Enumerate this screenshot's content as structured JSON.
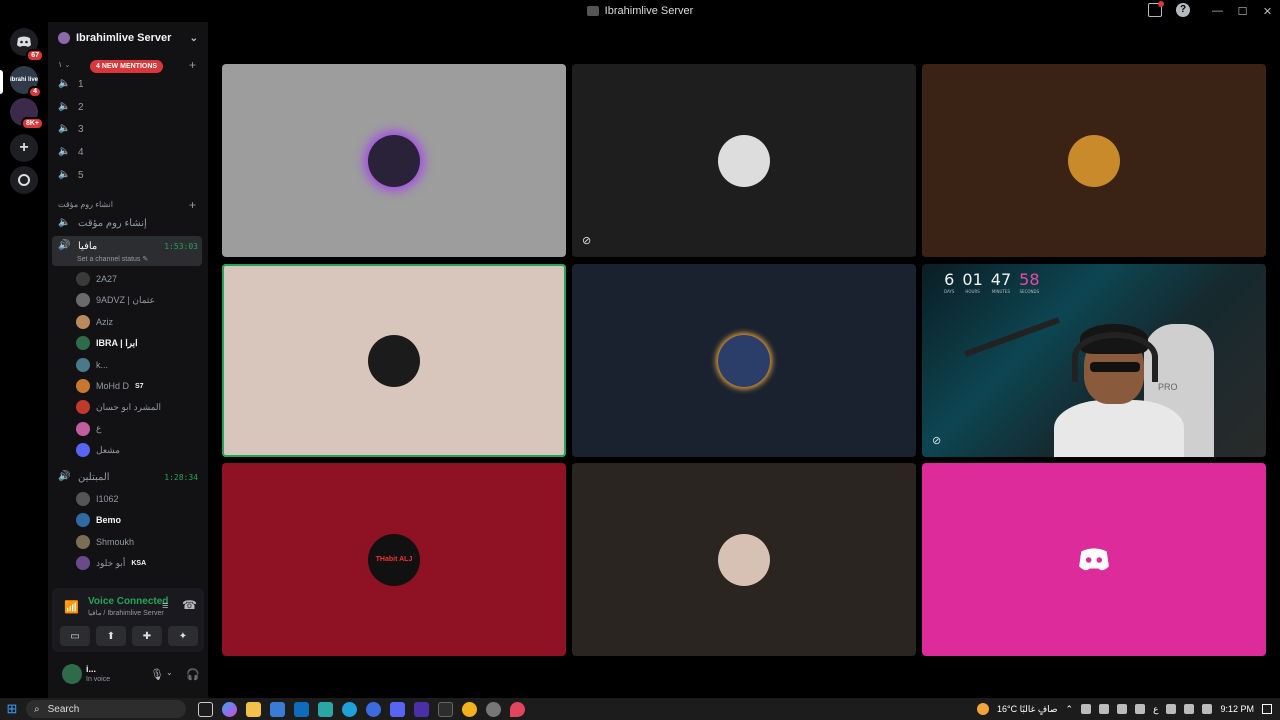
{
  "window": {
    "title": "Ibrahimlive Server",
    "controls": [
      "—",
      "☐",
      "✕"
    ]
  },
  "servers": {
    "home_badge": "67",
    "server1_label": "ibrahi live",
    "server1_badge": "4",
    "server2_badge": "8K+"
  },
  "sidebar": {
    "server_name": "Ibrahimlive Server",
    "mentions": "4 NEW MENTIONS",
    "collapse_marker": "١",
    "voice_channels": [
      "1",
      "2",
      "3",
      "4",
      "5"
    ],
    "temp_category": "انشاء روم مؤقت",
    "temp_channel": "إنشاء روم مؤقت",
    "active_channel": {
      "name": "مافيا",
      "timer": "1:53:03",
      "status_hint": "Set a channel status"
    },
    "members_active": [
      {
        "name": "2A27",
        "color": "#3a3a3a"
      },
      {
        "name": "9ADVZ | عثمان",
        "color": "#6a6a6a"
      },
      {
        "name": "Aziz",
        "color": "#b98a5a"
      },
      {
        "name": "IBRA | ابرا",
        "color": "#2e6b4a",
        "bright": true
      },
      {
        "name": "k...",
        "color": "#4a7a8a"
      },
      {
        "name": "MoHd D",
        "color": "#c8782e",
        "tag": "S7"
      },
      {
        "name": "المشرد ابو حسان",
        "color": "#c0392b"
      },
      {
        "name": "ع",
        "color": "#c25da0"
      },
      {
        "name": "مشعل",
        "color": "#5865f2"
      }
    ],
    "second_channel": {
      "name": "المبتلين",
      "timer": "1:28:34"
    },
    "members_second": [
      {
        "name": "I1062",
        "color": "#555"
      },
      {
        "name": "Bemo",
        "color": "#2f6aa3",
        "bright": true
      },
      {
        "name": "Shmoukh",
        "color": "#7a6f56"
      },
      {
        "name": "أبو خلود",
        "color": "#6b4a8a",
        "tag": "KSA"
      }
    ]
  },
  "voice": {
    "status": "Voice Connected",
    "location": "مافيا / Ibrahimlive Server"
  },
  "user_panel": {
    "name": "i...",
    "status": "In voice"
  },
  "stage": {
    "tiles": [
      {
        "label": "",
        "bg": "#9d9d9d",
        "pfp": "#2a2238"
      },
      {
        "label": "",
        "bg": "#1e1e1e",
        "pfp": "#dddddd"
      },
      {
        "label": "",
        "bg": "#3a2315",
        "pfp": "#c98a2b"
      },
      {
        "label": "",
        "bg": "#d8c6bc",
        "pfp": "#1b1b1b"
      },
      {
        "label": "",
        "bg": "#1a2230",
        "pfp": "#2b3e6a"
      },
      {
        "label": "",
        "bg": "#0e2a30",
        "pfp": ""
      },
      {
        "label": "THabit ALJ",
        "bg": "#8e1124",
        "pfp": "#111"
      },
      {
        "label": "",
        "bg": "#2a2520",
        "pfp": "#d7c0b4"
      },
      {
        "label": "",
        "bg": "#dd2b9b",
        "pfp": ""
      }
    ],
    "clock": {
      "days": "6",
      "hours": "01",
      "minutes": "47",
      "seconds": "58",
      "days_lbl": "DAYS",
      "hours_lbl": "HOURS",
      "minutes_lbl": "MINUTES",
      "seconds_lbl": "SECONDS"
    },
    "chair_text": "PRO"
  },
  "taskbar": {
    "search_placeholder": "Search",
    "weather": "16°C صافٍ غالبًا",
    "lang": "ع",
    "time": "9:12 PM"
  }
}
